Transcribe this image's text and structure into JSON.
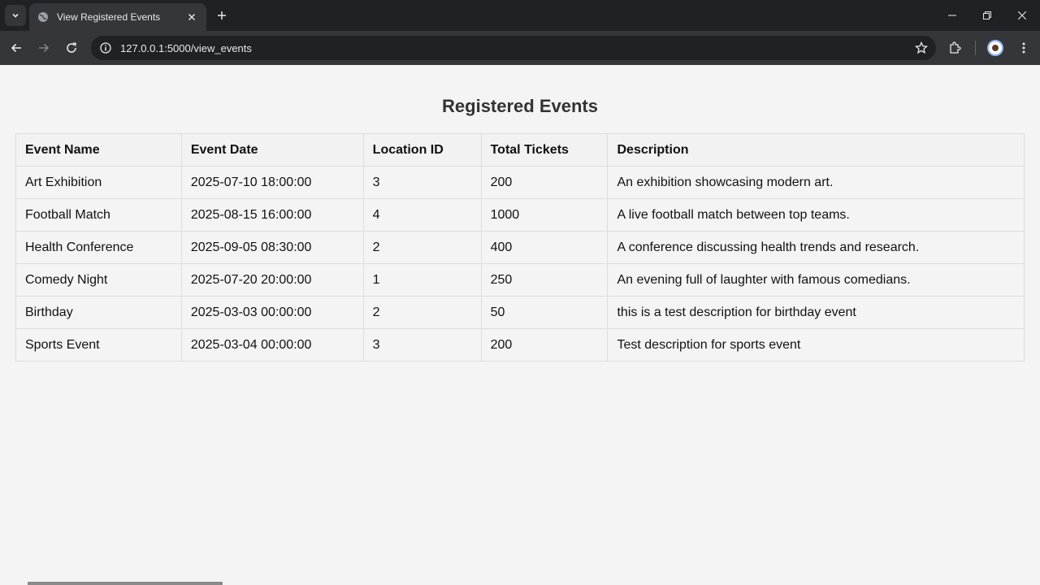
{
  "browser": {
    "tab_title": "View Registered Events",
    "url": "127.0.0.1:5000/view_events",
    "icons": [
      "tab-search-icon",
      "globe-icon",
      "close-icon",
      "plus-icon",
      "minimize-icon",
      "restore-icon",
      "window-close-icon",
      "back-icon",
      "forward-icon",
      "reload-icon",
      "site-info-icon",
      "star-icon",
      "extensions-icon",
      "profile-avatar",
      "more-icon"
    ]
  },
  "page": {
    "title": "Registered Events"
  },
  "table": {
    "headers": [
      "Event Name",
      "Event Date",
      "Location ID",
      "Total Tickets",
      "Description"
    ],
    "rows": [
      [
        "Art Exhibition",
        "2025-07-10 18:00:00",
        "3",
        "200",
        "An exhibition showcasing modern art."
      ],
      [
        "Football Match",
        "2025-08-15 16:00:00",
        "4",
        "1000",
        "A live football match between top teams."
      ],
      [
        "Health Conference",
        "2025-09-05 08:30:00",
        "2",
        "400",
        "A conference discussing health trends and research."
      ],
      [
        "Comedy Night",
        "2025-07-20 20:00:00",
        "1",
        "250",
        "An evening full of laughter with famous comedians."
      ],
      [
        "Birthday",
        "2025-03-03 00:00:00",
        "2",
        "50",
        "this is a test description for birthday event"
      ],
      [
        "Sports Event",
        "2025-03-04 00:00:00",
        "3",
        "200",
        "Test description for sports event"
      ]
    ]
  }
}
